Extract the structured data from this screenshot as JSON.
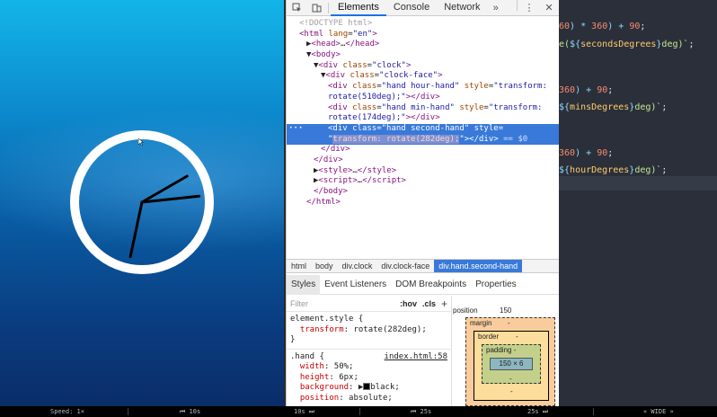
{
  "devtools": {
    "tabs": [
      "Elements",
      "Console",
      "Network"
    ],
    "more": "»",
    "dom_lines": [
      {
        "indent": 1,
        "html": "<span class='t-cmt'>&lt;!DOCTYPE html&gt;</span>"
      },
      {
        "indent": 1,
        "html": "<span class='t-tag'>&lt;html</span> <span class='t-attr'>lang</span>=<span class='t-val'>\"en\"</span><span class='t-tag'>&gt;</span>"
      },
      {
        "indent": 2,
        "html": "▶<span class='t-tag'>&lt;head&gt;</span>…<span class='t-tag'>&lt;/head&gt;</span>"
      },
      {
        "indent": 2,
        "html": "▼<span class='t-tag'>&lt;body&gt;</span>"
      },
      {
        "indent": 3,
        "html": "▼<span class='t-tag'>&lt;div</span> <span class='t-attr'>class</span>=<span class='t-val'>\"clock\"</span><span class='t-tag'>&gt;</span>"
      },
      {
        "indent": 4,
        "html": "▼<span class='t-tag'>&lt;div</span> <span class='t-attr'>class</span>=<span class='t-val'>\"clock-face\"</span><span class='t-tag'>&gt;</span>"
      },
      {
        "indent": 5,
        "html": "<span class='t-tag'>&lt;div</span> <span class='t-attr'>class</span>=<span class='t-val'>\"hand hour-hand\"</span> <span class='t-attr'>style</span>=<span class='t-val'>\"transform:</span>"
      },
      {
        "indent": 5,
        "html": "<span class='t-val'>rotate(510deg);\"</span><span class='t-tag'>&gt;&lt;/div&gt;</span>"
      },
      {
        "indent": 5,
        "html": "<span class='t-tag'>&lt;div</span> <span class='t-attr'>class</span>=<span class='t-val'>\"hand min-hand\"</span> <span class='t-attr'>style</span>=<span class='t-val'>\"transform:</span>"
      },
      {
        "indent": 5,
        "html": "<span class='t-val'>rotate(174deg);\"</span><span class='t-tag'>&gt;&lt;/div&gt;</span>"
      },
      {
        "indent": 5,
        "sel": true,
        "html": "<span class='t-tag'>&lt;div</span> <span class='t-attr'>class</span>=<span class='t-val'>\"hand second-hand\"</span> <span class='t-attr'>style</span>="
      },
      {
        "indent": 5,
        "sel": true,
        "html": "<span class='t-val'>\"</span><span class='hl'>transform: rotate(282deg);</span><span class='t-val'>\"</span><span class='t-tag'>&gt;&lt;/div&gt;</span> <span class='eq'>== $0</span>"
      },
      {
        "indent": 4,
        "html": "<span class='t-tag'>&lt;/div&gt;</span>"
      },
      {
        "indent": 3,
        "html": "<span class='t-tag'>&lt;/div&gt;</span>"
      },
      {
        "indent": 3,
        "html": "▶<span class='t-tag'>&lt;style&gt;</span>…<span class='t-tag'>&lt;/style&gt;</span>"
      },
      {
        "indent": 3,
        "html": "▶<span class='t-tag'>&lt;script&gt;</span>…<span class='t-tag'>&lt;/script&gt;</span>"
      },
      {
        "indent": 3,
        "html": "<span class='t-tag'>&lt;/body&gt;</span>"
      },
      {
        "indent": 2,
        "html": "<span class='t-tag'>&lt;/html&gt;</span>"
      }
    ],
    "breadcrumbs": [
      "html",
      "body",
      "div.clock",
      "div.clock-face",
      "div.hand.second-hand"
    ],
    "subtabs": [
      "Styles",
      "Event Listeners",
      "DOM Breakpoints",
      "Properties"
    ],
    "filter_placeholder": "Filter",
    "hov": ":hov",
    "cls": ".cls",
    "plus": "+",
    "element_style": {
      "selector": "element.style {",
      "prop": "transform",
      "value": "rotate(282deg);",
      "close": "}"
    },
    "hand_rule": {
      "selector": ".hand {",
      "source": "index.html:58",
      "props": [
        {
          "name": "width",
          "value": "50%;"
        },
        {
          "name": "height",
          "value": "6px;"
        },
        {
          "name": "background",
          "value": "black;"
        },
        {
          "name": "position",
          "value": "absolute;"
        }
      ]
    },
    "box_model": {
      "position_label": "position",
      "position_value": "150",
      "margin_label": "margin",
      "border_label": "border",
      "padding_label": "padding -",
      "content": "150 × 6",
      "dash": "-"
    }
  },
  "editor": {
    "lines": [
      {
        "html": "<span class='c-num'>60</span><span class='c-op'>)</span> <span class='c-op'>*</span> <span class='c-num'>360</span><span class='c-op'>)</span> <span class='c-op'>+</span> <span class='c-num'>90</span>;"
      },
      {
        "html": "<span class='c-str'>e(</span><span class='c-op'>${</span><span class='c-var'>secondsDegrees</span><span class='c-op'>}</span><span class='c-str'>deg)`</span>;"
      },
      {
        "html": "<span class='c-num'>360</span><span class='c-op'>)</span> <span class='c-op'>+</span> <span class='c-num'>90</span>;"
      },
      {
        "html": "<span class='c-op'>${</span><span class='c-var'>minsDegrees</span><span class='c-op'>}</span><span class='c-str'>deg)`</span>;"
      },
      {
        "html": "<span class='c-num'>360</span><span class='c-op'>)</span> <span class='c-op'>+</span> <span class='c-num'>90</span>;"
      },
      {
        "html": "<span class='c-op'>${</span><span class='c-var'>hourDegrees</span><span class='c-op'>}</span><span class='c-str'>deg)`</span>;"
      }
    ]
  },
  "clock": {
    "hour_deg": 510,
    "min_deg": 174,
    "sec_deg": 282
  },
  "player": {
    "speed": "Speed: 1×",
    "back10": "⏮ 10s",
    "fwd10": "10s ⏭",
    "back25": "⏮ 25s",
    "fwd25": "25s ⏭",
    "wide": "« WIDE »"
  }
}
